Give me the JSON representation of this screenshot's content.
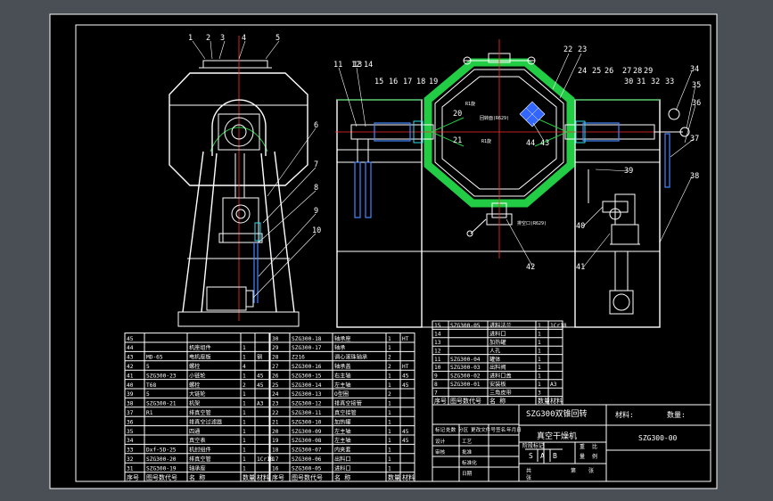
{
  "drawing": {
    "balloons": [
      "1",
      "2",
      "3",
      "4",
      "5",
      "6",
      "7",
      "8",
      "9",
      "10",
      "11",
      "12",
      "13",
      "14",
      "15",
      "16",
      "17",
      "18",
      "19",
      "20",
      "21",
      "22",
      "23",
      "24",
      "25",
      "26",
      "27",
      "28",
      "29",
      "30",
      "31",
      "32",
      "33",
      "34",
      "35",
      "36",
      "37",
      "38",
      "39",
      "40",
      "41",
      "42",
      "43",
      "44"
    ],
    "annotations": {
      "a1": "R1旋",
      "a2": "回转面(R629)",
      "a3": "R1旋",
      "a4": "排空口(R629)"
    }
  },
  "title_block": {
    "product_name": "SZG300双锥回转",
    "product_name_2": "真空干燥机",
    "material_label": "材料:",
    "quantity_label": "数量:",
    "drawing_number": "SZG300-00",
    "scale_label": "比",
    "scale_value": "例",
    "weight_label": "重",
    "weight_value": "量",
    "stage_marks": [
      "S",
      "A",
      "B"
    ],
    "sheet_total": "共",
    "sheet_label": "张",
    "sheet_no": "第",
    "sheet_label_2": "张",
    "rev_headers": [
      "标记",
      "处数",
      "分区",
      "更改文件号",
      "签名",
      "年月日"
    ],
    "sign_rows": [
      "设计",
      "审核",
      "工艺",
      "批准",
      "标准化",
      "日期"
    ],
    "stage_header": "阶段标记"
  },
  "bom_left": {
    "header": [
      "序号",
      "图号数代号",
      "名  称",
      "数量",
      "材料"
    ],
    "rows": [
      [
        "45",
        "",
        "",
        "",
        ""
      ],
      [
        "44",
        "",
        "机座组件",
        "1",
        ""
      ],
      [
        "43",
        "MD-65",
        "电机座板",
        "1",
        "钢"
      ],
      [
        "42",
        "5",
        "螺栓",
        "4",
        ""
      ],
      [
        "41",
        "SZG300-23",
        "小链轮",
        "1",
        "45"
      ],
      [
        "40",
        "T68",
        "螺栓",
        "2",
        "45"
      ],
      [
        "39",
        "5",
        "大链轮",
        "1",
        ""
      ],
      [
        "38",
        "SZG300-21",
        "机架",
        "1",
        "A3"
      ],
      [
        "37",
        "R1",
        "排真空管",
        "1",
        ""
      ],
      [
        "36",
        "",
        "排真空过滤器",
        "1",
        ""
      ],
      [
        "35",
        "",
        "四通",
        "1",
        ""
      ],
      [
        "34",
        "",
        "真空表",
        "1",
        ""
      ],
      [
        "33",
        "Dxf-5D-25",
        "机封组件",
        "1",
        ""
      ],
      [
        "32",
        "SZG300-20",
        "排真空管",
        "1",
        "1Cr18"
      ],
      [
        "31",
        "SZG300-19",
        "轴承座",
        "1",
        ""
      ]
    ]
  },
  "bom_mid": {
    "header": [
      "序号",
      "图号数代号",
      "名  称",
      "数量",
      "材料"
    ],
    "rows": [
      [
        "30",
        "SZG300-18",
        "轴承座",
        "1",
        "HT"
      ],
      [
        "29",
        "SZG300-17",
        "轴承",
        "1",
        ""
      ],
      [
        "28",
        "Z216",
        "调心滚珠轴承",
        "2",
        ""
      ],
      [
        "27",
        "SZG300-16",
        "轴承盖",
        "2",
        "HT"
      ],
      [
        "26",
        "SZG300-15",
        "右主轴",
        "1",
        "45"
      ],
      [
        "25",
        "SZG300-14",
        "左主轴",
        "1",
        "45"
      ],
      [
        "24",
        "SZG300-13",
        "O型圈",
        "2",
        ""
      ],
      [
        "23",
        "SZG300-12",
        "排真空接管",
        "1",
        ""
      ],
      [
        "22",
        "SZG300-11",
        "真空接管",
        "1",
        ""
      ],
      [
        "21",
        "SZG300-10",
        "加热罐",
        "1",
        ""
      ],
      [
        "20",
        "SZG300-09",
        "左主轴",
        "1",
        "45"
      ],
      [
        "19",
        "SZG300-08",
        "左主轴",
        "1",
        "45"
      ],
      [
        "18",
        "SZG300-07",
        "内夹套",
        "1",
        ""
      ],
      [
        "17",
        "SZG300-06",
        "出料口",
        "1",
        ""
      ],
      [
        "16",
        "SZG300-05",
        "进料口",
        "1",
        ""
      ]
    ]
  },
  "bom_right": {
    "header": [
      "序号",
      "图号数代号",
      "名  称",
      "数量",
      "材料"
    ],
    "rows": [
      [
        "15",
        "SZG300-05",
        "进料法兰",
        "1",
        "1Cr18"
      ],
      [
        "14",
        "",
        "进料口",
        "1",
        ""
      ],
      [
        "13",
        "",
        "加热罐",
        "1",
        ""
      ],
      [
        "12",
        "",
        "人孔",
        "1",
        ""
      ],
      [
        "11",
        "SZG300-04",
        "罐体",
        "1",
        ""
      ],
      [
        "10",
        "SZG300-03",
        "出料阀",
        "1",
        ""
      ],
      [
        "9",
        "SZG300-02",
        "进料口盖",
        "1",
        ""
      ],
      [
        "8",
        "SZG300-01",
        "安装板",
        "1",
        "A3"
      ],
      [
        "7",
        "",
        "三角皮带",
        "3",
        ""
      ]
    ]
  }
}
